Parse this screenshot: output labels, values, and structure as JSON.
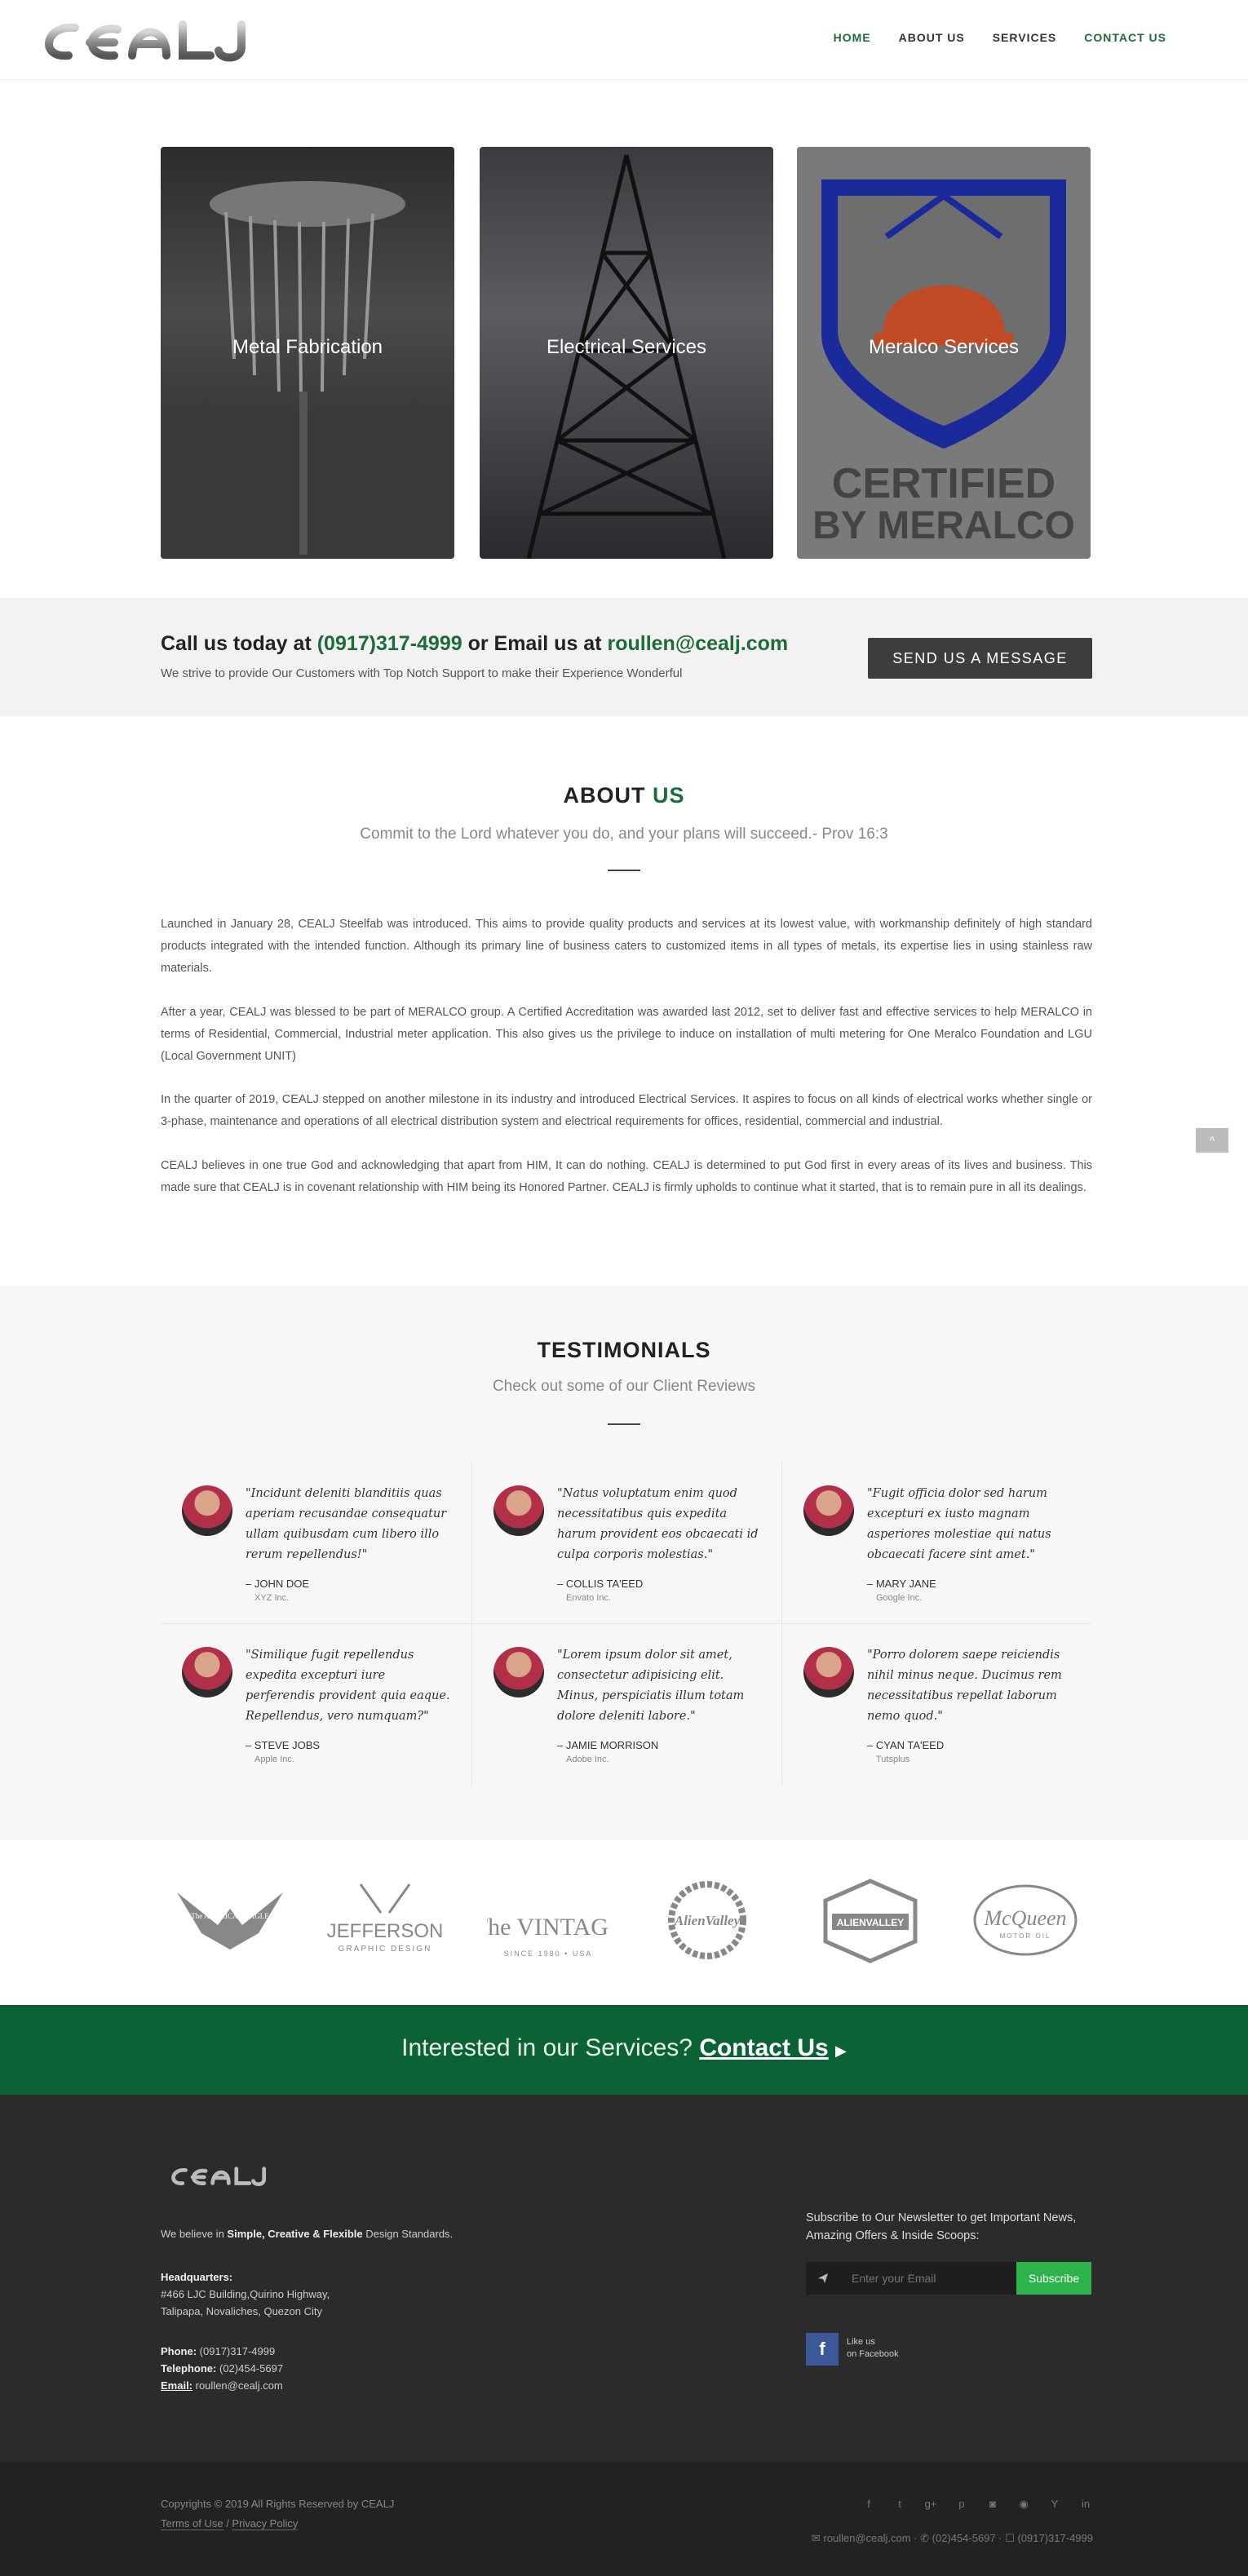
{
  "brand": {
    "logo_text": "CEALJ"
  },
  "nav": [
    {
      "label": "HOME"
    },
    {
      "label": "ABOUT US"
    },
    {
      "label": "SERVICES"
    },
    {
      "label": "CONTACT US"
    }
  ],
  "cards": [
    {
      "title": "Metal Fabrication"
    },
    {
      "title": "Electrical Services"
    },
    {
      "title": "Meralco Services",
      "badge": "CERTIFIED BY MERALCO"
    }
  ],
  "callbar": {
    "prefix": "Call us today at ",
    "phone": "(0917)317-4999",
    "middle": " or Email us at ",
    "email": "roullen@cealj.com",
    "subtitle": "We strive to provide Our Customers with Top Notch Support to make their Experience Wonderful",
    "button": "SEND US A MESSAGE"
  },
  "about": {
    "title_a": "ABOUT ",
    "title_b": "US",
    "subtitle": "Commit to the Lord whatever you do, and your plans will succeed.- Prov 16:3",
    "paragraphs": [
      "Launched in January 28, CEALJ Steelfab was introduced. This aims to provide quality products and services at its lowest value, with workmanship definitely of high standard products integrated with the intended function. Although its primary line of business caters to customized items in all types of metals, its expertise lies in using stainless raw materials.",
      "After a year, CEALJ was blessed to be part of MERALCO group. A Certified Accreditation was awarded last 2012, set to deliver fast and effective services to help MERALCO in terms of Residential, Commercial, Industrial meter application. This also gives us the privilege to induce on installation of multi metering for One Meralco Foundation and LGU (Local Government UNIT)",
      "In the quarter of 2019, CEALJ stepped on another milestone in its industry and introduced Electrical Services. It aspires to focus on all kinds of electrical works whether single or 3-phase, maintenance and operations of all electrical distribution system and electrical requirements for offices, residential, commercial and industrial.",
      "CEALJ believes in one true God and acknowledging that apart from HIM, It can do nothing. CEALJ is determined to put God first in every areas of its lives and business. This made sure that CEALJ is in covenant relationship with HIM being its Honored Partner. CEALJ is firmly upholds to continue what it started, that is to remain pure in all its dealings."
    ]
  },
  "scroll_top": "^",
  "testimonials": {
    "title": "TESTIMONIALS",
    "subtitle": "Check out some of our Client Reviews",
    "items": [
      {
        "quote": "\"Incidunt deleniti blanditiis quas aperiam recusandae consequatur ullam quibusdam cum libero illo rerum repellendus!\"",
        "name": "– JOHN DOE",
        "company": "XYZ Inc."
      },
      {
        "quote": "\"Natus voluptatum enim quod necessitatibus quis expedita harum provident eos obcaecati id culpa corporis molestias.\"",
        "name": "– COLLIS TA'EED",
        "company": "Envato Inc."
      },
      {
        "quote": "\"Fugit officia dolor sed harum excepturi ex iusto magnam asperiores molestiae qui natus obcaecati facere sint amet.\"",
        "name": "– MARY JANE",
        "company": "Google Inc."
      },
      {
        "quote": "\"Similique fugit repellendus expedita excepturi iure perferendis provident quia eaque. Repellendus, vero numquam?\"",
        "name": "– STEVE JOBS",
        "company": "Apple Inc."
      },
      {
        "quote": "\"Lorem ipsum dolor sit amet, consectetur adipisicing elit. Minus, perspiciatis illum totam dolore deleniti labore.\"",
        "name": "– JAMIE MORRISON",
        "company": "Adobe Inc."
      },
      {
        "quote": "\"Porro dolorem saepe reiciendis nihil minus neque. Ducimus rem necessitatibus repellat laborum nemo quod.\"",
        "name": "– CYAN TA'EED",
        "company": "Tutsplus"
      }
    ]
  },
  "client_logos": [
    {
      "text": "The AMERICAN EAGLE"
    },
    {
      "text": "JEFFERSON",
      "sub": "GRAPHIC DESIGN"
    },
    {
      "text": "The VINTAGE",
      "sub": "SINCE 1980 • USA"
    },
    {
      "text": "AlienValley"
    },
    {
      "text": "ALIENVALLEY"
    },
    {
      "text": "McQueen",
      "sub": "MOTOR OIL"
    }
  ],
  "cta": {
    "text": "Interested in our Services? ",
    "link": "Contact Us",
    "arrow": "▶"
  },
  "footer": {
    "tagline_a": "We believe in ",
    "tagline_b": "Simple, Creative & Flexible",
    "tagline_c": " Design Standards.",
    "hq_label": "Headquarters:",
    "hq_line1": "#466 LJC Building,Quirino Highway,",
    "hq_line2": "Talipapa, Novaliches, Quezon City",
    "phone_label": "Phone:",
    "phone": " (0917)317-4999",
    "tel_label": "Telephone:",
    "tel": " (02)454-5697",
    "email_label": "Email:",
    "email": " roullen@cealj.com",
    "newsletter": "Subscribe to Our Newsletter to get Important News, Amazing Offers & Inside Scoops:",
    "email_placeholder": "Enter your Email",
    "subscribe": "Subscribe",
    "fb_line1": "Like us",
    "fb_line2": "on Facebook"
  },
  "bottom": {
    "copyright": "Copyrights © 2019 All Rights Reserved by CEALJ",
    "terms": "Terms of Use",
    "sep": " / ",
    "privacy": "Privacy Policy",
    "contact_line": "✉ roullen@cealj.com · ✆ (02)454-5697 · ☐ (0917)317-4999"
  },
  "colors": {
    "brand_green": "#1e6b3a",
    "cta_green": "#0b6335",
    "subscribe_green": "#2db34a",
    "facebook": "#3b5998"
  }
}
